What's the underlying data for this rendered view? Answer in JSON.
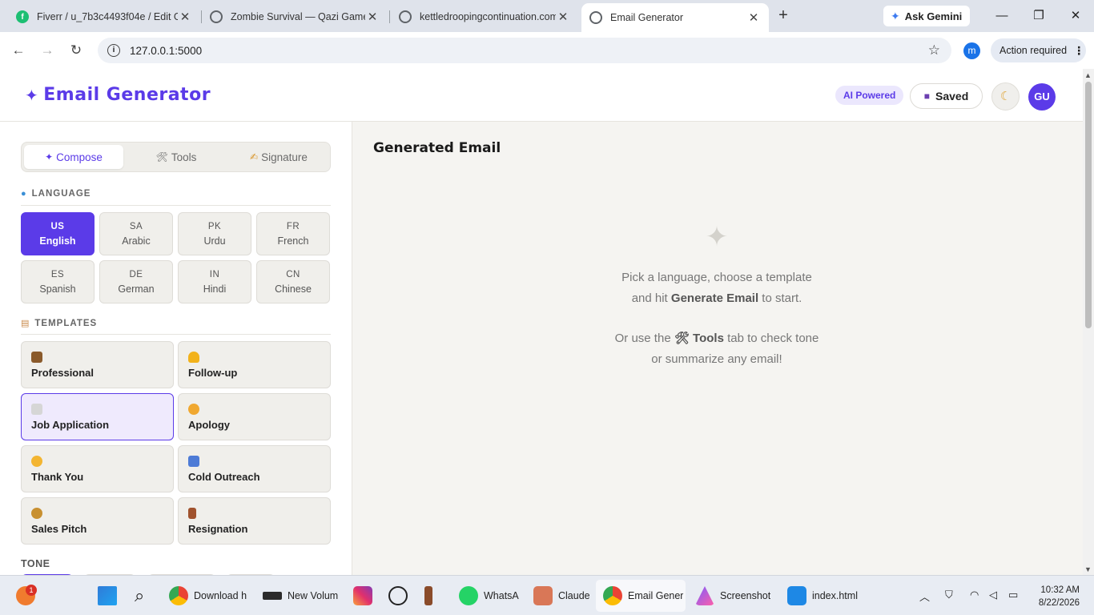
{
  "browser": {
    "tabs": [
      {
        "title": "Fiverr / u_7b3c4493f04e / Edit G",
        "favicon": "fiverr-icon",
        "color": "#1dbf73"
      },
      {
        "title": "Zombie Survival — Qazi Games",
        "favicon": "globe-icon",
        "color": "#5f6368"
      },
      {
        "title": "kettledroopingcontinuation.com",
        "favicon": "globe-icon",
        "color": "#5f6368"
      },
      {
        "title": "Email Generator",
        "favicon": "globe-icon",
        "color": "#5f6368",
        "active": true
      }
    ],
    "new_tab": "+",
    "ask_gemini": "Ask Gemini",
    "url": "127.0.0.1:5000",
    "profile_initial": "m",
    "action_required": "Action required"
  },
  "app": {
    "brand": "Email Generator",
    "brand_icon": "sparkle-icon",
    "ai_badge": "AI Powered",
    "saved_label": "Saved",
    "avatar": "GU",
    "tabs": [
      {
        "label": "Compose",
        "glyph": "✦"
      },
      {
        "label": "Tools",
        "glyph": "🛠"
      },
      {
        "label": "Signature",
        "glyph": "✍"
      }
    ],
    "language_title": "LANGUAGE",
    "languages": [
      {
        "code": "US",
        "name": "English",
        "selected": true
      },
      {
        "code": "SA",
        "name": "Arabic"
      },
      {
        "code": "PK",
        "name": "Urdu"
      },
      {
        "code": "FR",
        "name": "French"
      },
      {
        "code": "ES",
        "name": "Spanish"
      },
      {
        "code": "DE",
        "name": "German"
      },
      {
        "code": "IN",
        "name": "Hindi"
      },
      {
        "code": "CN",
        "name": "Chinese"
      }
    ],
    "templates_title": "TEMPLATES",
    "templates": [
      {
        "label": "Professional",
        "icon": "briefcase-icon",
        "color": "#8a5a2b"
      },
      {
        "label": "Follow-up",
        "icon": "bell-icon",
        "color": "#f2b21b"
      },
      {
        "label": "Job Application",
        "icon": "document-icon",
        "color": "#c9c9c9",
        "selected": true
      },
      {
        "label": "Apology",
        "icon": "person-bowing-icon",
        "color": "#f0a830"
      },
      {
        "label": "Thank You",
        "icon": "handshake-icon",
        "color": "#f3b531"
      },
      {
        "label": "Cold Outreach",
        "icon": "mailbox-icon",
        "color": "#4d7bd6"
      },
      {
        "label": "Sales Pitch",
        "icon": "money-bag-icon",
        "color": "#c89030"
      },
      {
        "label": "Resignation",
        "icon": "door-icon",
        "color": "#a0522d"
      }
    ],
    "tone_title": "TONE",
    "main_title": "Generated Email",
    "empty": {
      "line1": "Pick a language, choose a template",
      "line2_pre": "and hit ",
      "line2_bold": "Generate Email",
      "line2_post": " to start.",
      "line3_pre": "Or use the ",
      "line3_bold": "🛠 Tools",
      "line3_post": " tab to check tone",
      "line4": "or summarize any email!"
    },
    "accent": "#5b3be8"
  },
  "taskbar": {
    "items": [
      {
        "label": "Download h",
        "icon": "chrome-icon"
      },
      {
        "label": "New Volum",
        "icon": "terminal-icon"
      },
      {
        "label": "",
        "icon": "instagram-icon"
      },
      {
        "label": "",
        "icon": "chatgpt-icon"
      },
      {
        "label": "",
        "icon": "figure-icon"
      },
      {
        "label": "WhatsA",
        "icon": "whatsapp-icon"
      },
      {
        "label": "Claude",
        "icon": "claude-icon"
      },
      {
        "label": "Email Gener",
        "icon": "chrome-icon"
      },
      {
        "label": "Screenshot",
        "icon": "screenshot-icon"
      },
      {
        "label": "index.html",
        "icon": "vscode-icon"
      }
    ],
    "time": "10:32 AM",
    "date": "8/22/2026",
    "notification_count": "1"
  }
}
